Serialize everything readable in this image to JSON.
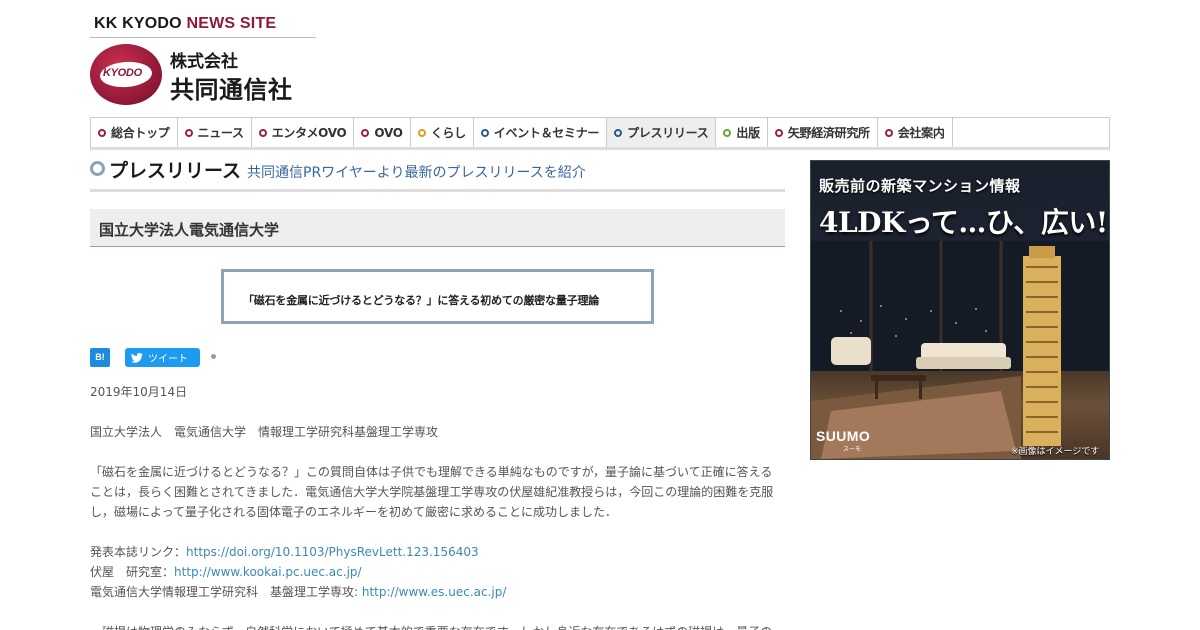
{
  "header": {
    "site_name_prefix": "KK KYODO ",
    "site_name_suffix": "NEWS SITE",
    "logo_text": "KYODO",
    "company_small": "株式会社",
    "company_big": "共同通信社"
  },
  "nav": {
    "items": [
      {
        "label": "総合トップ",
        "dot": "red"
      },
      {
        "label": "ニュース",
        "dot": "red"
      },
      {
        "label": "エンタメOVO",
        "dot": "red"
      },
      {
        "label": "OVO",
        "dot": "red"
      },
      {
        "label": "くらし",
        "dot": "orange"
      },
      {
        "label": "イベント＆セミナー",
        "dot": "blue"
      },
      {
        "label": "プレスリリース",
        "dot": "blue",
        "active": true
      },
      {
        "label": "出版",
        "dot": "green"
      },
      {
        "label": "矢野経済研究所",
        "dot": "red"
      },
      {
        "label": "会社案内",
        "dot": "red"
      }
    ]
  },
  "section": {
    "title": "プレスリリース",
    "subtitle": "共同通信PRワイヤーより最新のプレスリリースを紹介"
  },
  "article": {
    "organization": "国立大学法人電気通信大学",
    "headline": "「磁石を金属に近づけるとどうなる？」に答える初めての厳密な量子理論",
    "share": {
      "hatena": "B!",
      "tweet": "ツイート"
    },
    "date": "2019年10月14日",
    "affiliation": "国立大学法人　電気通信大学　情報理工学研究科基盤理工学専攻",
    "paragraph1": "「磁石を金属に近づけるとどうなる？」この質問自体は子供でも理解できる単純なものですが，量子論に基づいて正確に答えることは，長らく困難とされてきました．電気通信大学大学院基盤理工学専攻の伏屋雄紀准教授らは，今回この理論的困難を克服し，磁場によって量子化される固体電子のエネルギーを初めて厳密に求めることに成功しました．",
    "links": [
      {
        "label": "発表本誌リンク：",
        "url": "https://doi.org/10.1103/PhysRevLett.123.156403"
      },
      {
        "label": "伏屋　研究室：",
        "url": "http://www.kookai.pc.uec.ac.jp/"
      },
      {
        "label": "電気通信大学情報理工学研究科　基盤理工学専攻: ",
        "url": "http://www.es.uec.ac.jp/"
      }
    ],
    "paragraph2_partial": "　磁場は物理学のみならず，自然科学において極めて基本的で重要な存在です．しかし身近な存在であるはずの磁場は，量子の"
  },
  "ad": {
    "line1": "販売前の新築マンション情報",
    "line2": "4LDKって…ひ、広い!",
    "brand": "suumo",
    "brand_sub": "スーモ",
    "note": "※画像はイメージです"
  }
}
